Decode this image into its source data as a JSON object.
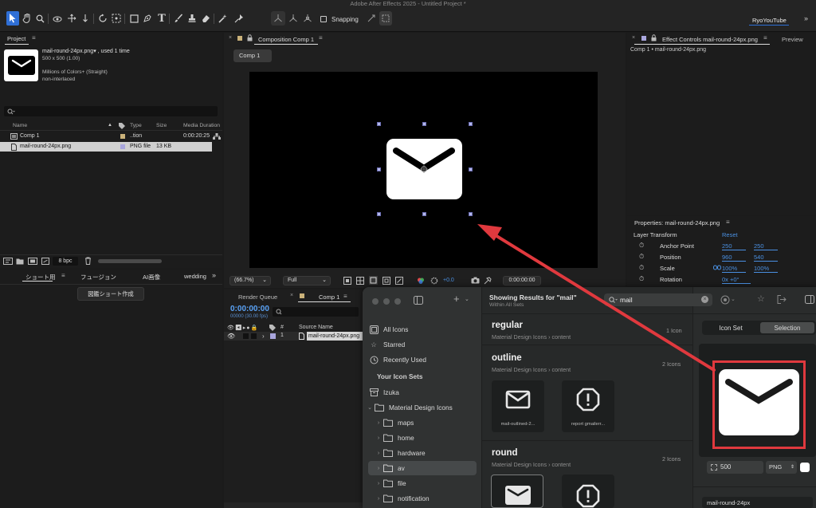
{
  "app_title": "Adobe After Effects 2025 - Untitled Project *",
  "workspace": "RyoYouTube",
  "snapping_label": "Snapping",
  "project": {
    "panel_title": "Project",
    "item_name": "mail-round-24px.png▾ , used 1 time",
    "dims": "500 x 500 (1.00)",
    "colors": "Millions of Colors+ (Straight)",
    "interlace": "non-interlaced",
    "columns": [
      "Name",
      "Type",
      "Size",
      "Media Duration"
    ],
    "rows": [
      {
        "name": "Comp 1",
        "type": "..tion",
        "size": "",
        "duration": "0:00:20:25"
      },
      {
        "name": "mail-round-24px.png",
        "type": "PNG file",
        "size": "13 KB",
        "duration": ""
      }
    ],
    "bpc": "8 bpc"
  },
  "lower_left": {
    "tabs": [
      "ショート用",
      "フュージョン",
      "AI画像",
      "wedding"
    ],
    "button": "図鑑ショート作成"
  },
  "composition": {
    "tab_title": "Composition Comp 1",
    "comp_chip": "Comp 1",
    "zoom": "(66.7%)",
    "resolution": "Full",
    "exposure": "+0.0",
    "timecode": "0:00:00:00"
  },
  "effect_controls": {
    "tab_title": "Effect Controls mail-round-24px.png",
    "preview_tab": "Preview",
    "breadcrumb": "Comp 1 • mail-round-24px.png"
  },
  "properties": {
    "title": "Properties: mail-round-24px.png",
    "section": "Layer Transform",
    "reset": "Reset",
    "rows": [
      {
        "label": "Anchor Point",
        "v1": "250",
        "v2": "250"
      },
      {
        "label": "Position",
        "v1": "960",
        "v2": "540"
      },
      {
        "label": "Scale",
        "v1": "100%",
        "v2": "100%"
      },
      {
        "label": "Rotation",
        "v1": "0x +0°",
        "v2": ""
      }
    ]
  },
  "timeline": {
    "render_queue": "Render Queue",
    "comp_tab": "Comp 1",
    "timecode": "0:00:00:00",
    "fps": "00000 (30.00 fps)",
    "source_name_col": "Source Name",
    "hash_col": "#",
    "layer_num": "1",
    "layer_name": "mail-round-24px.png"
  },
  "icon_app": {
    "search_heading": "Showing Results for \"mail\"",
    "search_sub": "Within All Sets",
    "search_value": "mail",
    "sidebar": {
      "all_icons": "All Icons",
      "starred": "Starred",
      "recent": "Recently Used",
      "your_sets": "Your Icon Sets",
      "izuka": "Izuka",
      "mdi": "Material Design Icons",
      "folders": [
        "maps",
        "home",
        "hardware",
        "av",
        "file",
        "notification"
      ]
    },
    "results": [
      {
        "title": "regular",
        "sub": "Material Design Icons  ›  content",
        "count": "1 Icon"
      },
      {
        "title": "outline",
        "sub": "Material Design Icons  ›  content",
        "count": "2 Icons",
        "tiles": [
          "mail-outlined-2...",
          "report gmailerr..."
        ]
      },
      {
        "title": "round",
        "sub": "Material Design Icons  ›  content",
        "count": "2 Icons"
      }
    ],
    "seg_icon_set": "Icon Set",
    "seg_selection": "Selection",
    "size_value": "500",
    "format": "PNG",
    "filename": "mail-round-24px"
  },
  "colors": {
    "accent_blue": "#2f6fd6",
    "annotation_red": "#e0393e",
    "link_blue": "#4a90e2"
  }
}
